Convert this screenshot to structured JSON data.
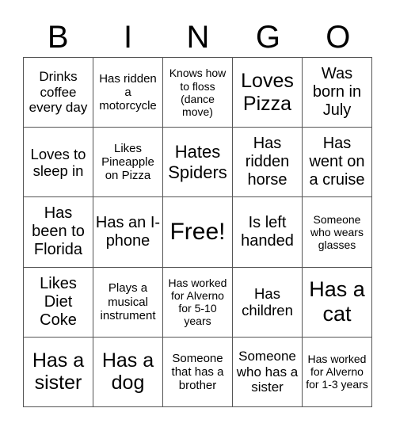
{
  "header": [
    "B",
    "I",
    "N",
    "G",
    "O"
  ],
  "cells": [
    "Drinks coffee every day",
    "Has ridden a motorcycle",
    "Knows how to floss (dance move)",
    "Loves Pizza",
    "Was born in July",
    "Loves to sleep in",
    "Likes Pineapple on Pizza",
    "Hates Spiders",
    "Has ridden horse",
    "Has went on a cruise",
    "Has been to Florida",
    "Has an I-phone",
    "Free!",
    "Is left handed",
    "Someone who wears glasses",
    "Likes Diet Coke",
    "Plays a musical instrument",
    "Has worked for Alverno for 5-10 years",
    "Has children",
    "Has a cat",
    "Has a sister",
    "Has a dog",
    "Someone that has a brother",
    "Someone who has a sister",
    "Has worked for Alverno for 1-3 years"
  ]
}
